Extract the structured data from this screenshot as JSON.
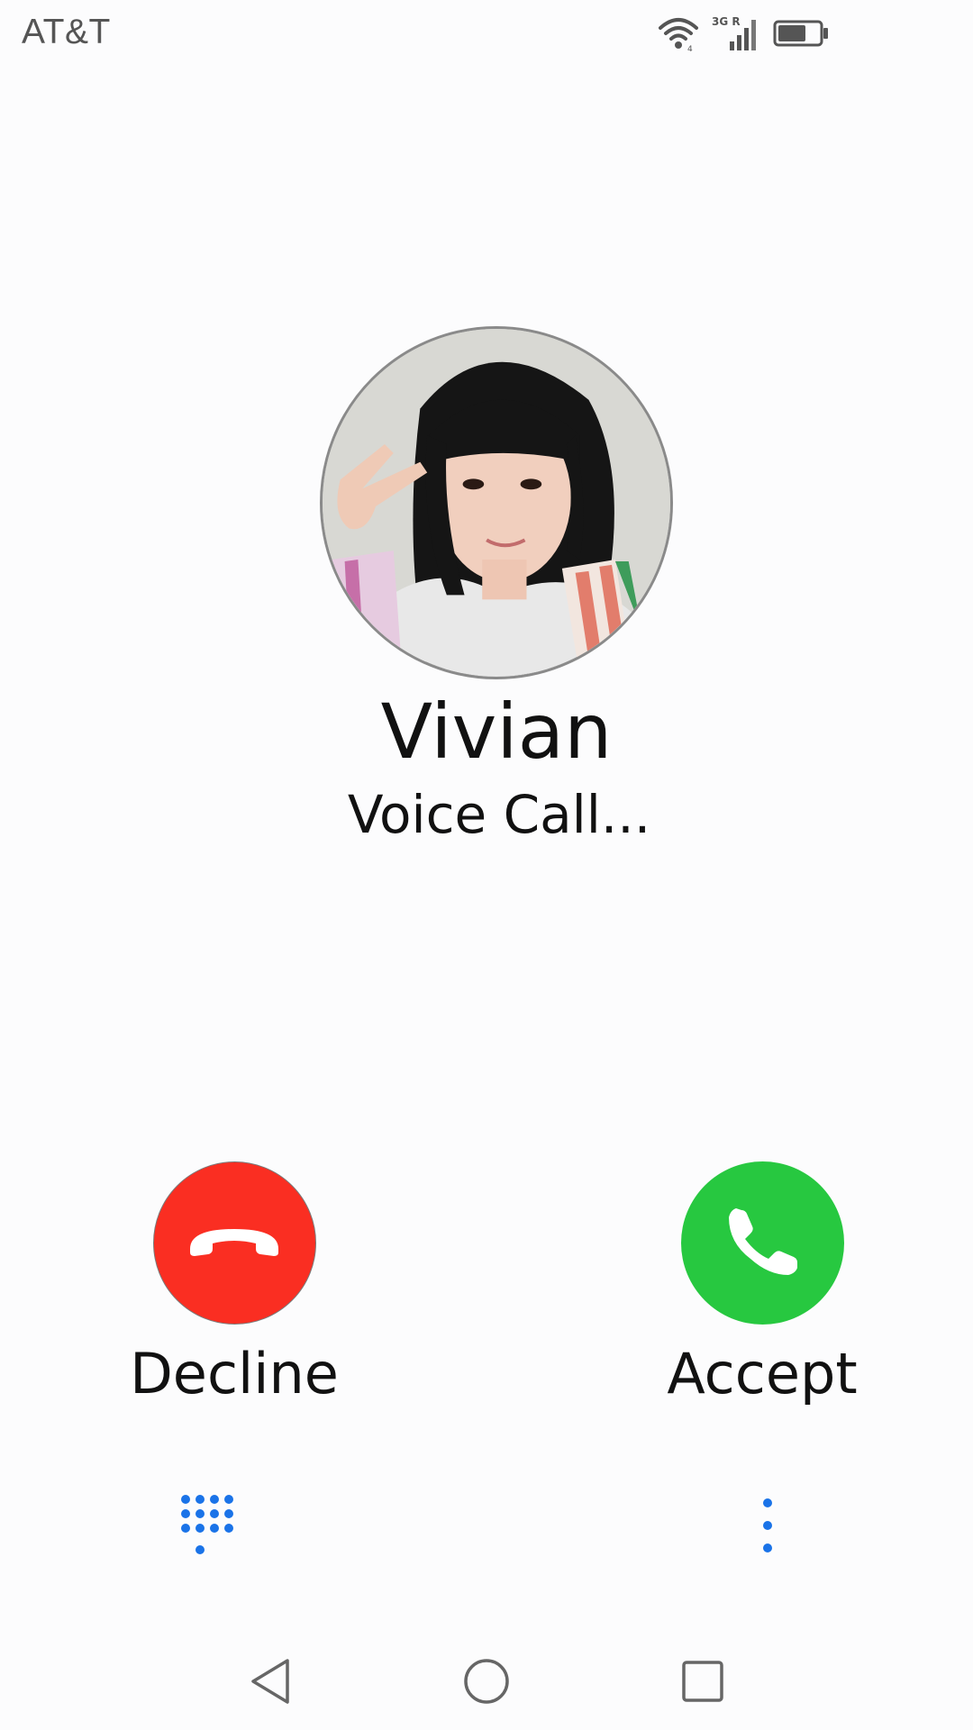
{
  "status_bar": {
    "carrier": "AT&T",
    "network_label": "3G R",
    "icons": [
      "wifi-icon",
      "cellular-signal-icon",
      "battery-icon"
    ]
  },
  "caller": {
    "name": "Vivian",
    "call_type": "Voice Call..."
  },
  "actions": {
    "decline_label": "Decline",
    "accept_label": "Accept",
    "decline_color": "#fa2e22",
    "accept_color": "#27c840"
  },
  "controls": {
    "dialpad_icon": "dialpad-icon",
    "more_icon": "more-vertical-icon",
    "accent_color": "#1a73e8"
  },
  "navigation": {
    "icons": [
      "back-icon",
      "home-icon",
      "recent-apps-icon"
    ]
  }
}
